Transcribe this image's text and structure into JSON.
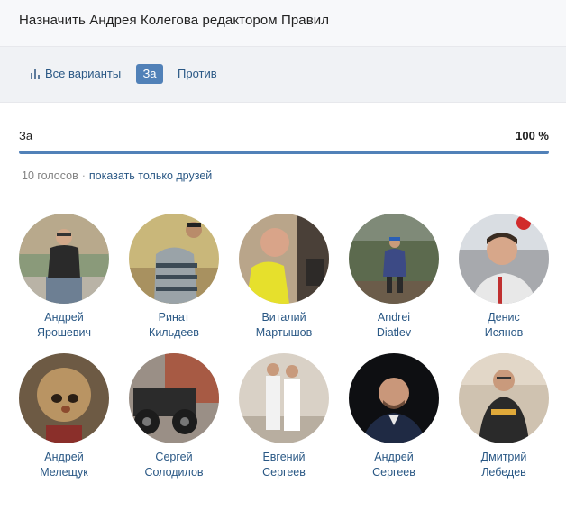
{
  "header": {
    "title": "Назначить Андрея Колегова редактором Правил"
  },
  "tabs": {
    "all_label": "Все варианты",
    "for_label": "За",
    "against_label": "Против"
  },
  "result": {
    "label": "За",
    "percent_text": "100 %",
    "fill_fraction": 1.0
  },
  "meta": {
    "votes_text": "10 голосов",
    "separator": "·",
    "friends_link": "показать только друзей"
  },
  "colors": {
    "accent": "#5181b8",
    "link": "#2a5885",
    "track": "#dfe6ee"
  },
  "voters": [
    {
      "first": "Андрей",
      "last": "Ярошевич"
    },
    {
      "first": "Ринат",
      "last": "Кильдеев"
    },
    {
      "first": "Виталий",
      "last": "Мартышов"
    },
    {
      "first": "Andrei",
      "last": "Diatlev"
    },
    {
      "first": "Денис",
      "last": "Исянов"
    },
    {
      "first": "Андрей",
      "last": "Мелещук"
    },
    {
      "first": "Сергей",
      "last": "Солодилов"
    },
    {
      "first": "Евгений",
      "last": "Сергеев"
    },
    {
      "first": "Андрей",
      "last": "Сергеев"
    },
    {
      "first": "Дмитрий",
      "last": "Лебедев"
    }
  ]
}
